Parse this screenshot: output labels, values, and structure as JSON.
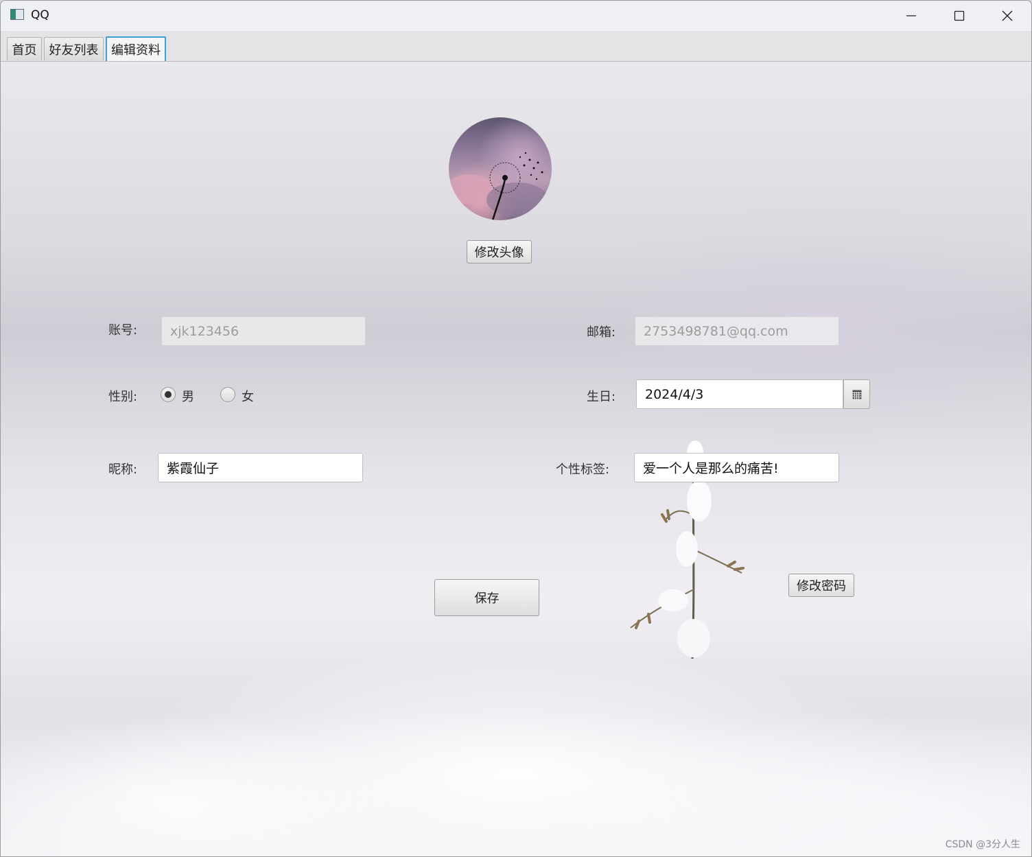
{
  "window": {
    "title": "QQ"
  },
  "tabs": [
    {
      "label": "首页"
    },
    {
      "label": "好友列表"
    },
    {
      "label": "编辑资料",
      "active": true
    }
  ],
  "profile": {
    "change_avatar_label": "修改头像",
    "account": {
      "label": "账号:",
      "value": "xjk123456"
    },
    "email": {
      "label": "邮箱:",
      "value": "2753498781@qq.com"
    },
    "gender": {
      "label": "性别:",
      "options": [
        "男",
        "女"
      ],
      "selected": "男"
    },
    "birthday": {
      "label": "生日:",
      "value": "2024/4/3"
    },
    "nickname": {
      "label": "昵称:",
      "value": "紫霞仙子"
    },
    "signature": {
      "label": "个性标签:",
      "value": "爱一个人是那么的痛苦!"
    },
    "save_label": "保存",
    "change_password_label": "修改密码"
  },
  "watermark": "CSDN @3分人生",
  "colors": {
    "active_tab_border": "#3fa0d8",
    "background": "#e6e4ea"
  },
  "icons": [
    "app-icon",
    "minimize-icon",
    "maximize-icon",
    "close-icon",
    "calendar-icon"
  ]
}
